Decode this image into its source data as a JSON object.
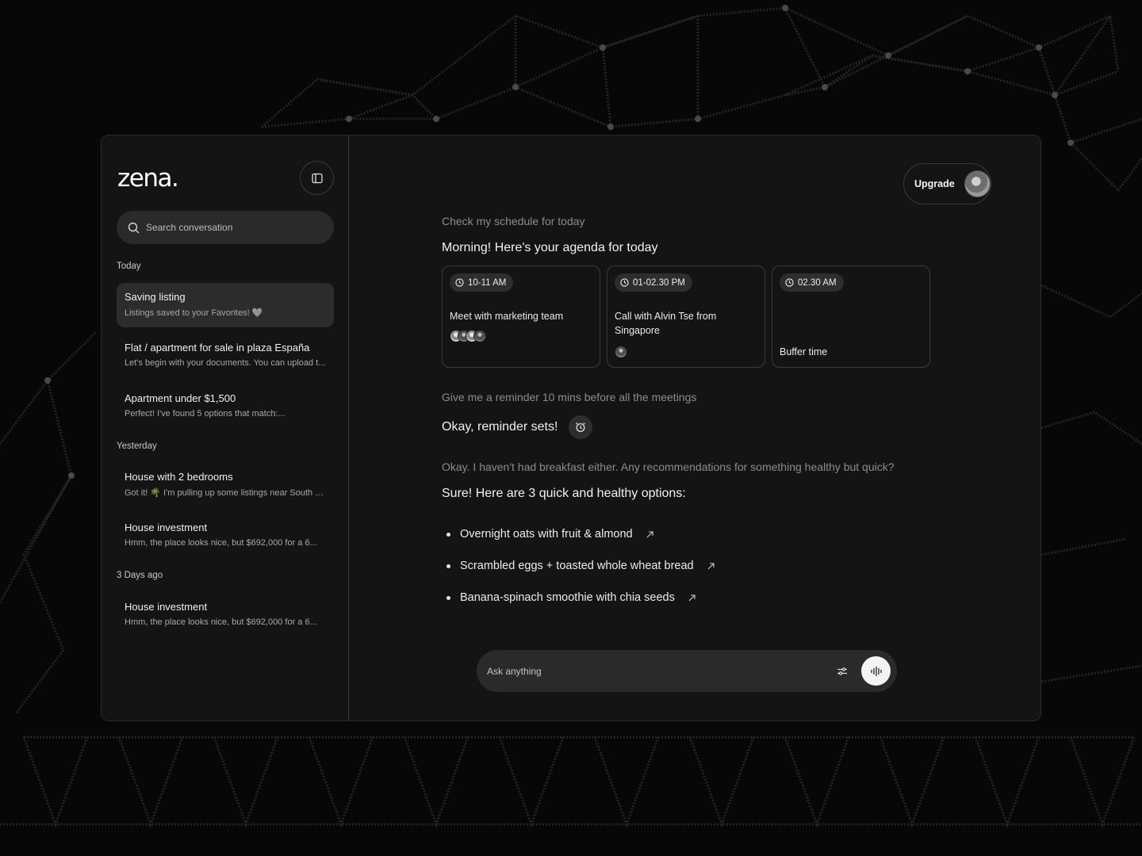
{
  "app": {
    "logo": "zena."
  },
  "sidebar": {
    "search_placeholder": "Search conversation",
    "groups": [
      {
        "label": "Today",
        "items": [
          {
            "title": "Saving listing",
            "preview": "Listings saved to your Favorites! 🩶",
            "active": true
          },
          {
            "title": "Flat / apartment for sale in plaza España",
            "preview": "Let's begin with your documents. You can upload t..."
          },
          {
            "title": "Apartment under $1,500",
            "preview": "Perfect! I've found 5 options that match:..."
          }
        ]
      },
      {
        "label": "Yesterday",
        "items": [
          {
            "title": "House with 2 bedrooms",
            "preview": "Got it! 🌴 I'm pulling up some listings near South B..."
          },
          {
            "title": "House investment",
            "preview": "Hmm, the place looks nice, but $692,000 for a 6..."
          }
        ]
      },
      {
        "label": "3 Days ago",
        "items": [
          {
            "title": "House investment",
            "preview": "Hmm, the place looks nice, but $692,000 for a 6..."
          }
        ]
      }
    ]
  },
  "header": {
    "upgrade_label": "Upgrade"
  },
  "chat": {
    "prompt1": "Check my schedule for today",
    "reply1": "Morning! Here's your agenda for today",
    "cards": [
      {
        "time": "10-11 AM",
        "title": "Meet with marketing team"
      },
      {
        "time": "01-02.30 PM",
        "title": "Call with Alvin Tse from Singapore"
      },
      {
        "time": "02.30 AM",
        "title": "Buffer time"
      }
    ],
    "prompt2": "Give me a reminder 10 mins before all the meetings",
    "reply2": "Okay, reminder sets!",
    "prompt3": "Okay. I haven't had breakfast either. Any recommendations for something healthy but quick?",
    "reply3": "Sure! Here are 3 quick and healthy options:",
    "options": [
      "Overnight oats with fruit & almond",
      "Scrambled eggs + toasted whole wheat bread",
      "Banana-spinach smoothie with chia seeds"
    ]
  },
  "composer": {
    "placeholder": "Ask anything"
  }
}
